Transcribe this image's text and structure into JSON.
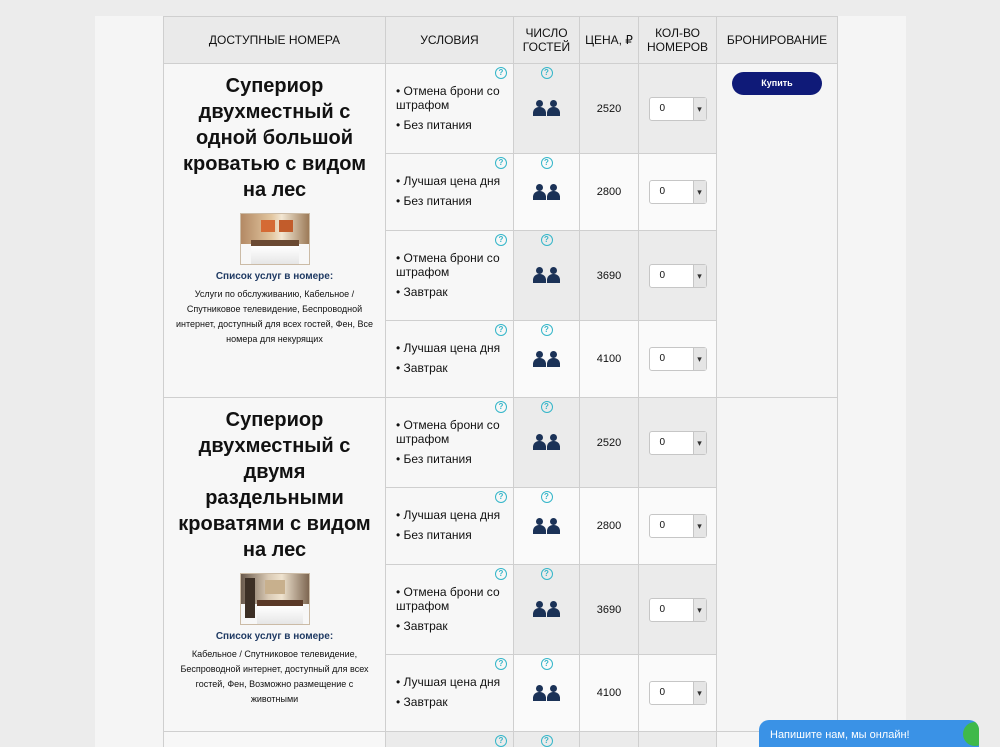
{
  "header": {
    "room": "ДОСТУПНЫЕ НОМЕРА",
    "conditions": "УСЛОВИЯ",
    "guests": "ЧИСЛО ГОСТЕЙ",
    "price": "ЦЕНА, ₽",
    "qty": "КОЛ-ВО НОМЕРОВ",
    "booking": "БРОНИРОВАНИЕ"
  },
  "help_glyph": "?",
  "select_arrow": "▾",
  "buy_label": "Купить",
  "services_title": "Список услуг в номере:",
  "rooms": [
    {
      "title": "Супериор двухместный с одной большой кроватью с видом на лес",
      "photo_icon": "room-photo",
      "services": "Услуги по обслуживанию, Кабельное / Спутниковое телевидение, Беспроводной интернет, доступный для всех гостей, Фен, Все номера для некурящих",
      "rates": [
        {
          "cancel": "• Отмена брони со штрафом",
          "meal": "• Без питания",
          "price": "2520",
          "qty": "0"
        },
        {
          "cancel": "• Лучшая цена дня",
          "meal": "• Без питания",
          "price": "2800",
          "qty": "0"
        },
        {
          "cancel": "• Отмена брони со штрафом",
          "meal": "• Завтрак",
          "price": "3690",
          "qty": "0"
        },
        {
          "cancel": "• Лучшая цена дня",
          "meal": "• Завтрак",
          "price": "4100",
          "qty": "0"
        }
      ]
    },
    {
      "title": "Супериор двухместный с двумя раздельными кроватями с видом на лес",
      "photo_icon": "room-photo",
      "services": "Кабельное / Спутниковое телевидение, Беспроводной интернет, доступный для всех гостей, Фен, Возможно размещение с животными",
      "rates": [
        {
          "cancel": "• Отмена брони со штрафом",
          "meal": "• Без питания",
          "price": "2520",
          "qty": "0"
        },
        {
          "cancel": "• Лучшая цена дня",
          "meal": "• Без питания",
          "price": "2800",
          "qty": "0"
        },
        {
          "cancel": "• Отмена брони со штрафом",
          "meal": "• Завтрак",
          "price": "3690",
          "qty": "0"
        },
        {
          "cancel": "• Лучшая цена дня",
          "meal": "• Завтрак",
          "price": "4100",
          "qty": "0"
        }
      ]
    }
  ],
  "chat": {
    "label": "Напишите нам, мы онлайн!"
  },
  "colors": {
    "buy_button": "#0f1a78",
    "help_icon": "#35b6c9",
    "guest_icon": "#1b3257",
    "chat": "#3a92e6",
    "chat_dot": "#3fb94a",
    "services_title": "#1f3a63"
  }
}
